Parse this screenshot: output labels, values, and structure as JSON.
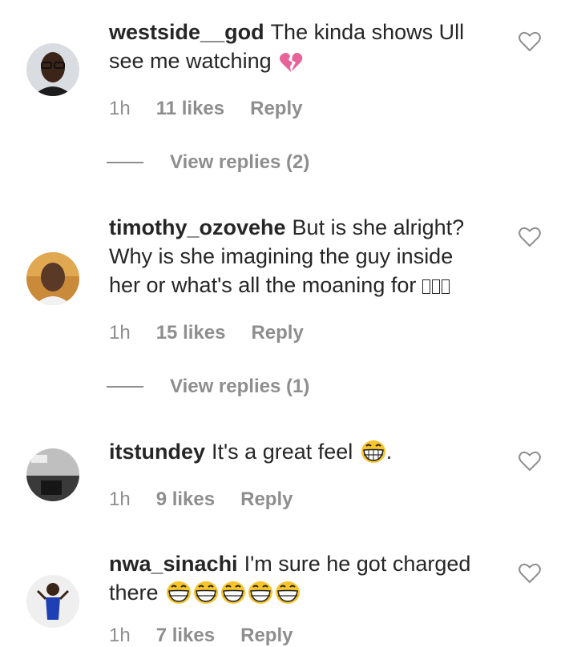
{
  "comments": [
    {
      "username": "westside__god",
      "text": "The kinda shows Ull see me watching",
      "emoji": "broken-heart",
      "time": "1h",
      "likes": "11 likes",
      "reply": "Reply",
      "view_replies": "View replies (2)"
    },
    {
      "username": "timothy_ozovehe",
      "text": "But is she alright? Why is she imagining the guy inside her or what's all the moaning for",
      "emoji": "unsupported-glyphs",
      "time": "1h",
      "likes": "15 likes",
      "reply": "Reply",
      "view_replies": "View replies (1)"
    },
    {
      "username": "itstundey",
      "text": "It's a great feel",
      "emoji": "grinning-face",
      "trailing": ".",
      "time": "1h",
      "likes": "9 likes",
      "reply": "Reply"
    },
    {
      "username": "nwa_sinachi",
      "text": "I'm sure he got charged there",
      "emoji": "grinning-face x5",
      "time": "1h",
      "likes": "7 likes",
      "reply": "Reply"
    }
  ],
  "colors": {
    "text": "#262626",
    "muted": "#8e8e8e",
    "broken_heart": "#e8639a",
    "emoji_yellow": "#f7c42b"
  }
}
